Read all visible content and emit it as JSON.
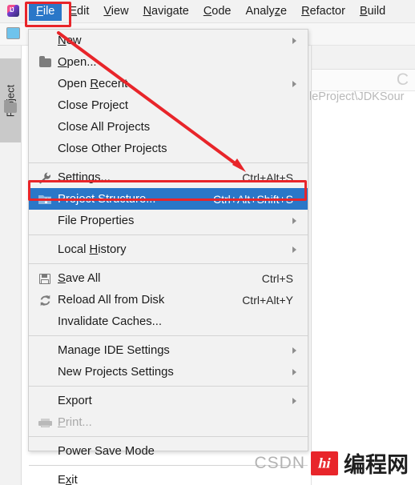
{
  "app": {
    "logo_text": "IJ",
    "logo_name": "intellij-idea-logo"
  },
  "menubar": {
    "items": [
      {
        "label": "File",
        "mnemonic": "F",
        "active": true
      },
      {
        "label": "Edit",
        "mnemonic": "E",
        "active": false
      },
      {
        "label": "View",
        "mnemonic": "V",
        "active": false
      },
      {
        "label": "Navigate",
        "mnemonic": "N",
        "active": false
      },
      {
        "label": "Code",
        "mnemonic": "C",
        "active": false
      },
      {
        "label": "Analyze",
        "mnemonic": "z",
        "active": false
      },
      {
        "label": "Refactor",
        "mnemonic": "R",
        "active": false
      },
      {
        "label": "Build",
        "mnemonic": "B",
        "active": false
      }
    ]
  },
  "sidebar": {
    "tool_window_label": "Project"
  },
  "editor": {
    "path_ghost": "leProject\\JDKSour",
    "ghost_glyph": "C"
  },
  "file_menu": {
    "rows": [
      {
        "label": "New",
        "mnemonic": "N",
        "accel": "",
        "submenu": true,
        "icon": "",
        "disabled": false,
        "selected": false,
        "sep_after": false
      },
      {
        "label": "Open...",
        "mnemonic": "O",
        "accel": "",
        "submenu": false,
        "icon": "folder",
        "disabled": false,
        "selected": false,
        "sep_after": false
      },
      {
        "label": "Open Recent",
        "mnemonic": "R",
        "accel": "",
        "submenu": true,
        "icon": "",
        "disabled": false,
        "selected": false,
        "sep_after": false
      },
      {
        "label": "Close Project",
        "mnemonic": "",
        "accel": "",
        "submenu": false,
        "icon": "",
        "disabled": false,
        "selected": false,
        "sep_after": false
      },
      {
        "label": "Close All Projects",
        "mnemonic": "",
        "accel": "",
        "submenu": false,
        "icon": "",
        "disabled": false,
        "selected": false,
        "sep_after": false
      },
      {
        "label": "Close Other Projects",
        "mnemonic": "",
        "accel": "",
        "submenu": false,
        "icon": "",
        "disabled": false,
        "selected": false,
        "sep_after": true
      },
      {
        "label": "Settings...",
        "mnemonic": "t",
        "accel": "Ctrl+Alt+S",
        "submenu": false,
        "icon": "wrench",
        "disabled": false,
        "selected": false,
        "sep_after": false
      },
      {
        "label": "Project Structure...",
        "mnemonic": "",
        "accel": "Ctrl+Alt+Shift+S",
        "submenu": false,
        "icon": "struct",
        "disabled": false,
        "selected": true,
        "sep_after": false
      },
      {
        "label": "File Properties",
        "mnemonic": "",
        "accel": "",
        "submenu": true,
        "icon": "",
        "disabled": false,
        "selected": false,
        "sep_after": true
      },
      {
        "label": "Local History",
        "mnemonic": "H",
        "accel": "",
        "submenu": true,
        "icon": "",
        "disabled": false,
        "selected": false,
        "sep_after": true
      },
      {
        "label": "Save All",
        "mnemonic": "S",
        "accel": "Ctrl+S",
        "submenu": false,
        "icon": "save",
        "disabled": false,
        "selected": false,
        "sep_after": false
      },
      {
        "label": "Reload All from Disk",
        "mnemonic": "",
        "accel": "Ctrl+Alt+Y",
        "submenu": false,
        "icon": "reload",
        "disabled": false,
        "selected": false,
        "sep_after": false
      },
      {
        "label": "Invalidate Caches...",
        "mnemonic": "",
        "accel": "",
        "submenu": false,
        "icon": "",
        "disabled": false,
        "selected": false,
        "sep_after": true
      },
      {
        "label": "Manage IDE Settings",
        "mnemonic": "",
        "accel": "",
        "submenu": true,
        "icon": "",
        "disabled": false,
        "selected": false,
        "sep_after": false
      },
      {
        "label": "New Projects Settings",
        "mnemonic": "",
        "accel": "",
        "submenu": true,
        "icon": "",
        "disabled": false,
        "selected": false,
        "sep_after": true
      },
      {
        "label": "Export",
        "mnemonic": "",
        "accel": "",
        "submenu": true,
        "icon": "",
        "disabled": false,
        "selected": false,
        "sep_after": false
      },
      {
        "label": "Print...",
        "mnemonic": "P",
        "accel": "",
        "submenu": false,
        "icon": "print",
        "disabled": true,
        "selected": false,
        "sep_after": true
      },
      {
        "label": "Power Save Mode",
        "mnemonic": "",
        "accel": "",
        "submenu": false,
        "icon": "",
        "disabled": false,
        "selected": false,
        "sep_after": true
      },
      {
        "label": "Exit",
        "mnemonic": "x",
        "accel": "",
        "submenu": false,
        "icon": "",
        "disabled": false,
        "selected": false,
        "sep_after": false
      }
    ]
  },
  "annotations": {
    "accent_color": "#e8252a",
    "highlight_color": "#2a77c8",
    "boxes": [
      {
        "name": "file-menu-highlight"
      },
      {
        "name": "project-structure-highlight"
      }
    ],
    "arrow": {
      "from": "File menu",
      "to": "Project Structure..."
    }
  },
  "watermark": {
    "csdn": "CSDN",
    "logo_mark": "hi",
    "site": "编程网"
  }
}
